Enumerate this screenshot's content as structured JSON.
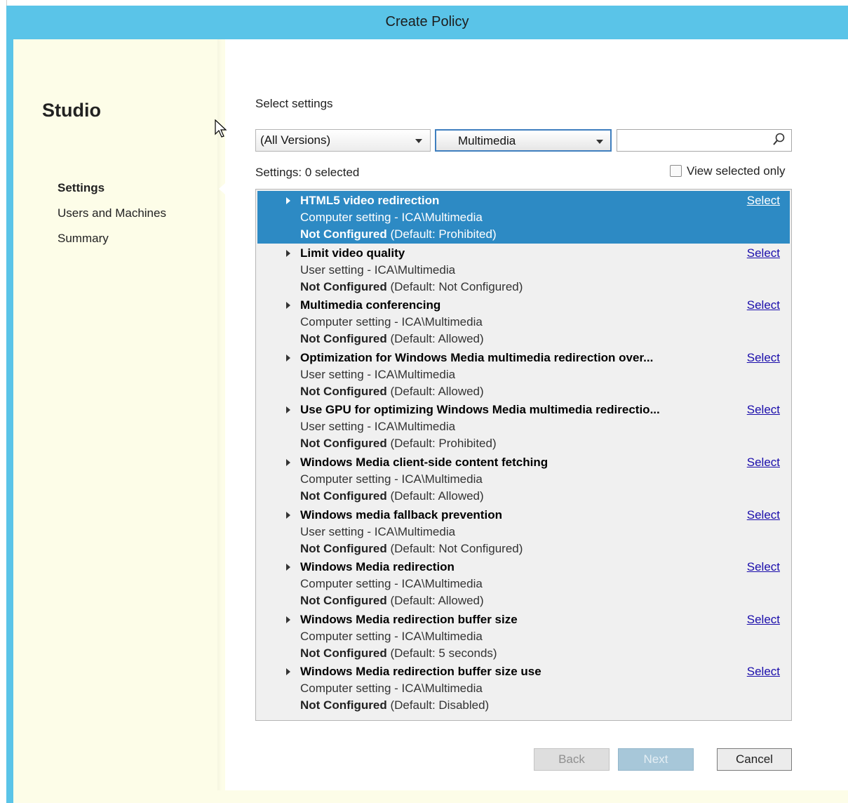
{
  "window": {
    "title": "Create Policy"
  },
  "sidebar": {
    "app_name": "Studio",
    "items": [
      {
        "label": "Settings"
      },
      {
        "label": "Users and Machines"
      },
      {
        "label": "Summary"
      }
    ]
  },
  "main": {
    "heading": "Select settings",
    "version_filter": "(All Versions)",
    "category_filter": "Multimedia",
    "search_value": "",
    "counter": "Settings: 0 selected",
    "view_selected_label": "View selected only",
    "settings": [
      {
        "name": "HTML5 video redirection",
        "scope": "Computer setting - ICA\\Multimedia",
        "state": "Not Configured",
        "default": "(Default: Prohibited)",
        "action": "Select",
        "selected": true
      },
      {
        "name": "Limit video quality",
        "scope": "User setting - ICA\\Multimedia",
        "state": "Not Configured",
        "default": "(Default: Not Configured)",
        "action": "Select"
      },
      {
        "name": "Multimedia conferencing",
        "scope": "Computer setting - ICA\\Multimedia",
        "state": "Not Configured",
        "default": "(Default: Allowed)",
        "action": "Select"
      },
      {
        "name": "Optimization for Windows Media multimedia redirection over...",
        "scope": "User setting - ICA\\Multimedia",
        "state": "Not Configured",
        "default": "(Default: Allowed)",
        "action": "Select"
      },
      {
        "name": "Use GPU for optimizing Windows Media multimedia redirectio...",
        "scope": "User setting - ICA\\Multimedia",
        "state": "Not Configured",
        "default": "(Default: Prohibited)",
        "action": "Select"
      },
      {
        "name": "Windows Media client-side content fetching",
        "scope": "Computer setting - ICA\\Multimedia",
        "state": "Not Configured",
        "default": "(Default: Allowed)",
        "action": "Select"
      },
      {
        "name": "Windows media fallback prevention",
        "scope": "User setting - ICA\\Multimedia",
        "state": "Not Configured",
        "default": "(Default: Not Configured)",
        "action": "Select"
      },
      {
        "name": "Windows Media redirection",
        "scope": "Computer setting - ICA\\Multimedia",
        "state": "Not Configured",
        "default": "(Default: Allowed)",
        "action": "Select"
      },
      {
        "name": "Windows Media redirection buffer size",
        "scope": "Computer setting - ICA\\Multimedia",
        "state": "Not Configured",
        "default": "(Default: 5  seconds)",
        "action": "Select"
      },
      {
        "name": "Windows Media redirection buffer size use",
        "scope": "Computer setting - ICA\\Multimedia",
        "state": "Not Configured",
        "default": "(Default: Disabled)",
        "action": "Select"
      }
    ]
  },
  "footer": {
    "back_label": "Back",
    "next_label": "Next",
    "cancel_label": "Cancel"
  },
  "colors": {
    "titlebar": "#5ac4e8",
    "selection": "#2d8ac4",
    "link": "#1a0dab"
  }
}
